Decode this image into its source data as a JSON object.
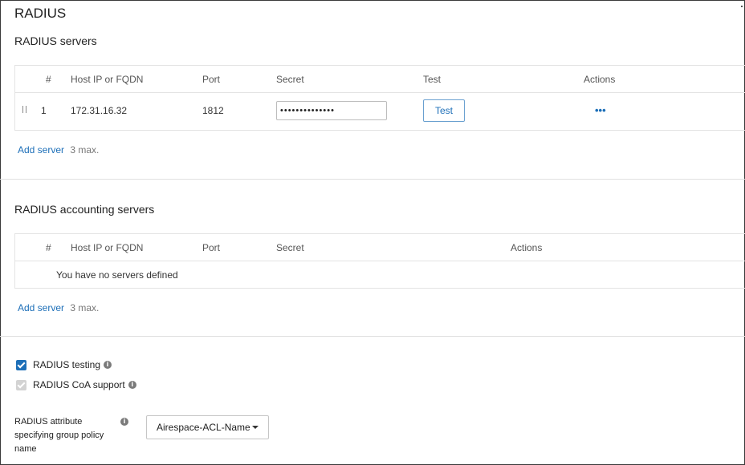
{
  "page": {
    "title": "RADIUS"
  },
  "radius_servers": {
    "title": "RADIUS servers",
    "columns": {
      "num": "#",
      "host": "Host IP or FQDN",
      "port": "Port",
      "secret": "Secret",
      "test": "Test",
      "actions": "Actions"
    },
    "rows": [
      {
        "num": "1",
        "host": "172.31.16.32",
        "port": "1812",
        "secret": "••••••••••••••",
        "test_label": "Test",
        "actions_icon": "more-horizontal-icon"
      }
    ],
    "add_label": "Add server",
    "max_note": "3 max."
  },
  "accounting_servers": {
    "title": "RADIUS accounting servers",
    "columns": {
      "num": "#",
      "host": "Host IP or FQDN",
      "port": "Port",
      "secret": "Secret",
      "actions": "Actions"
    },
    "empty_message": "You have no servers defined",
    "add_label": "Add server",
    "max_note": "3 max."
  },
  "options": {
    "radius_testing": {
      "label": "RADIUS testing",
      "checked": true,
      "disabled": false
    },
    "coa_support": {
      "label": "RADIUS CoA support",
      "checked": true,
      "disabled": true
    }
  },
  "group_policy": {
    "label": "RADIUS attribute specifying group policy name",
    "selected": "Airespace-ACL-Name"
  },
  "colors": {
    "accent": "#1d6fb8",
    "border": "#e3e3e3",
    "disabled": "#d3d3d3"
  }
}
